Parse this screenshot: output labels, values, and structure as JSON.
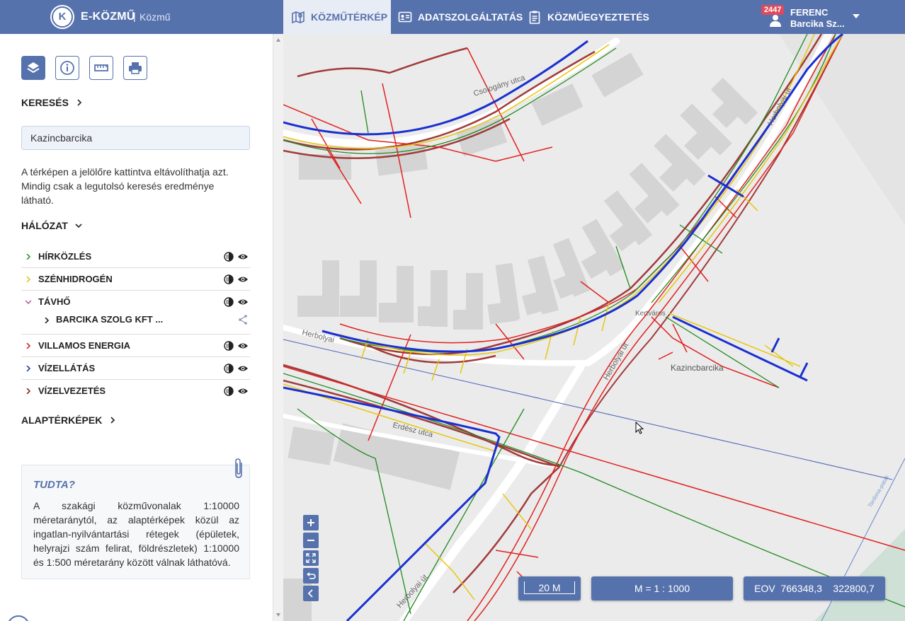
{
  "header": {
    "logo_letter": "K",
    "brand": "E-KÖZMŰ",
    "separator": "|",
    "brand_sub": "Közmű",
    "tabs": [
      {
        "label": "KÖZMŰTÉRKÉP",
        "icon": "map-icon",
        "active": true
      },
      {
        "label": "ADATSZOLGÁLTATÁS",
        "icon": "id-card-icon",
        "active": false
      },
      {
        "label": "KÖZMŰEGYEZTETÉS",
        "icon": "clipboard-icon",
        "active": false
      }
    ],
    "user": {
      "badge": "2447",
      "name": "FERENC",
      "org": "Barcika Sz..."
    }
  },
  "sidebar": {
    "tools": [
      "layers-icon",
      "info-icon",
      "ruler-icon",
      "print-icon"
    ],
    "search_heading": "KERESÉS",
    "search_value": "Kazincbarcika",
    "search_info": "A térképen a jelölőre kattintva eltávolíthatja azt. Mindig csak a legutolsó keresés eredménye látható.",
    "network_heading": "HÁLÓZAT",
    "layers": [
      {
        "label": "HÍRKÖZLÉS",
        "color": "#2f9a3a",
        "expanded": false
      },
      {
        "label": "SZÉNHIDROGÉN",
        "color": "#e2c31c",
        "expanded": false
      },
      {
        "label": "TÁVHŐ",
        "color": "#b56a9a",
        "expanded": true
      },
      {
        "label": "VILLAMOS ENERGIA",
        "color": "#d52b2b",
        "expanded": false
      },
      {
        "label": "VÍZELLÁTÁS",
        "color": "#2a3ea8",
        "expanded": false
      },
      {
        "label": "VÍZELVEZETÉS",
        "color": "#8a2a2a",
        "expanded": false
      }
    ],
    "sublayer": {
      "label": "BARCIKA SZOLG KFT ..."
    },
    "basemaps_heading": "ALAPTÉRKÉPEK",
    "tip": {
      "title": "TUDTA?",
      "text": "A szakági közművonalak 1:10000 méretaránytól, az alaptérképek közül az ingatlan-nyilvántartási rétegek (épületek, helyrajzi szám felirat, földrészletek) 1:10000 és 1:500 méretarány között válnak láthatóvá."
    }
  },
  "map": {
    "street_labels": [
      "Csologány utca",
      "Herbolyai út",
      "Herbolyai út",
      "Herbolyai",
      "Erdész utca",
      "Herbolyai út",
      "Kertváros",
      "Tardona-patak"
    ],
    "place_label": "Kazincbarcika",
    "scale_label": "20 M",
    "ratio_label": "M = 1 : 1000",
    "coords_label": "EOV  766348,3    322800,7",
    "colors": {
      "vizellatas": "#1a2fd0",
      "vizelvezetes": "#a13a3a",
      "villamos": "#e0211f",
      "hirkozles": "#1e8a1e",
      "szenhidrogen": "#e7c400",
      "building": "#d2d2d2"
    }
  }
}
